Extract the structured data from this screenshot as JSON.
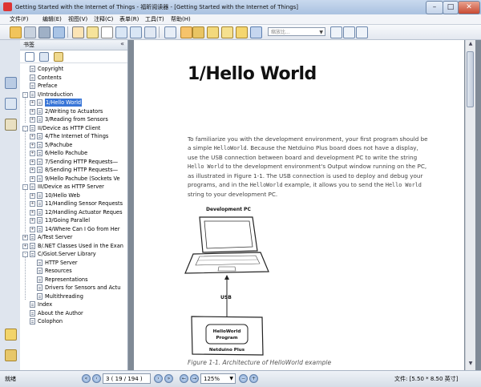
{
  "window": {
    "title": "Getting Started with the Internet of Things - 福昕阅读器 - [Getting Started with the Internet of Things]"
  },
  "menu": [
    "文件(F)",
    "编辑(E)",
    "视图(V)",
    "注释(C)",
    "表单(R)",
    "工具(T)",
    "帮助(H)"
  ],
  "toolbar": {
    "zoom_placeholder": "缩放比..."
  },
  "bookmarks": {
    "panel_title": "书签",
    "items": [
      {
        "label": "Copyright",
        "level": 0,
        "expander": ""
      },
      {
        "label": "Contents",
        "level": 0,
        "expander": ""
      },
      {
        "label": "Preface",
        "level": 0,
        "expander": ""
      },
      {
        "label": "I/Introduction",
        "level": 0,
        "expander": "-"
      },
      {
        "label": "1/Hello World",
        "level": 1,
        "expander": "+",
        "selected": true
      },
      {
        "label": "2/Writing to Actuators",
        "level": 1,
        "expander": "+"
      },
      {
        "label": "3/Reading from Sensors",
        "level": 1,
        "expander": "+"
      },
      {
        "label": "II/Device as HTTP Client",
        "level": 0,
        "expander": "-"
      },
      {
        "label": "4/The Internet of Things",
        "level": 1,
        "expander": "+"
      },
      {
        "label": "5/Pachube",
        "level": 1,
        "expander": "+"
      },
      {
        "label": "6/Hello Pachube",
        "level": 1,
        "expander": "+"
      },
      {
        "label": "7/Sending HTTP Requests—",
        "level": 1,
        "expander": "+"
      },
      {
        "label": "8/Sending HTTP Requests—",
        "level": 1,
        "expander": "+"
      },
      {
        "label": "9/Hello Pachube (Sockets Ve",
        "level": 1,
        "expander": "+"
      },
      {
        "label": "III/Device as HTTP Server",
        "level": 0,
        "expander": "-"
      },
      {
        "label": "10/Hello Web",
        "level": 1,
        "expander": "+"
      },
      {
        "label": "11/Handling Sensor Requests",
        "level": 1,
        "expander": "+"
      },
      {
        "label": "12/Handling Actuator Reques",
        "level": 1,
        "expander": "+"
      },
      {
        "label": "13/Going Parallel",
        "level": 1,
        "expander": "+"
      },
      {
        "label": "14/Where Can I Go from Her",
        "level": 1,
        "expander": "+"
      },
      {
        "label": "A/Test Server",
        "level": 0,
        "expander": "+"
      },
      {
        "label": "B/.NET Classes Used in the Exan",
        "level": 0,
        "expander": "+"
      },
      {
        "label": "C/Gsiot.Server Library",
        "level": 0,
        "expander": "-"
      },
      {
        "label": "HTTP Server",
        "level": 1,
        "expander": ""
      },
      {
        "label": "Resources",
        "level": 1,
        "expander": ""
      },
      {
        "label": "Representations",
        "level": 1,
        "expander": ""
      },
      {
        "label": "Drivers for Sensors and Actu",
        "level": 1,
        "expander": ""
      },
      {
        "label": "Multithreading",
        "level": 1,
        "expander": ""
      },
      {
        "label": "Index",
        "level": 0,
        "expander": ""
      },
      {
        "label": "About the Author",
        "level": 0,
        "expander": ""
      },
      {
        "label": "Colophon",
        "level": 0,
        "expander": ""
      }
    ]
  },
  "page": {
    "heading": "1/Hello World",
    "paragraph": [
      {
        "t": "To familiarize you with the development environment, your first program should be a simple "
      },
      {
        "c": "HelloWorld"
      },
      {
        "t": ". Because the Netduino Plus board does not have a display, use the USB connection between board and development PC to write the string "
      },
      {
        "c": "Hello World"
      },
      {
        "t": " to the development environment's Output window running on the PC, as illustrated in Figure 1-1. The USB connection is used to deploy and debug your programs, and in the "
      },
      {
        "c": "HelloWorld"
      },
      {
        "t": " example, it allows you to send the "
      },
      {
        "c": "Hello World"
      },
      {
        "t": " string to your development PC."
      }
    ],
    "figure": {
      "dev_pc_label": "Development PC",
      "usb_label": "USB",
      "program_line1": "HelloWorld",
      "program_line2": "Program",
      "board_label": "Netduino Plus"
    },
    "caption": "Figure 1-1. Architecture of HelloWorld example"
  },
  "status": {
    "ready": "就绪",
    "page_display": "3  ( 19 / 194 )",
    "zoom": "125%",
    "file_size": "文件: [5.50 * 8.50 英寸]"
  }
}
